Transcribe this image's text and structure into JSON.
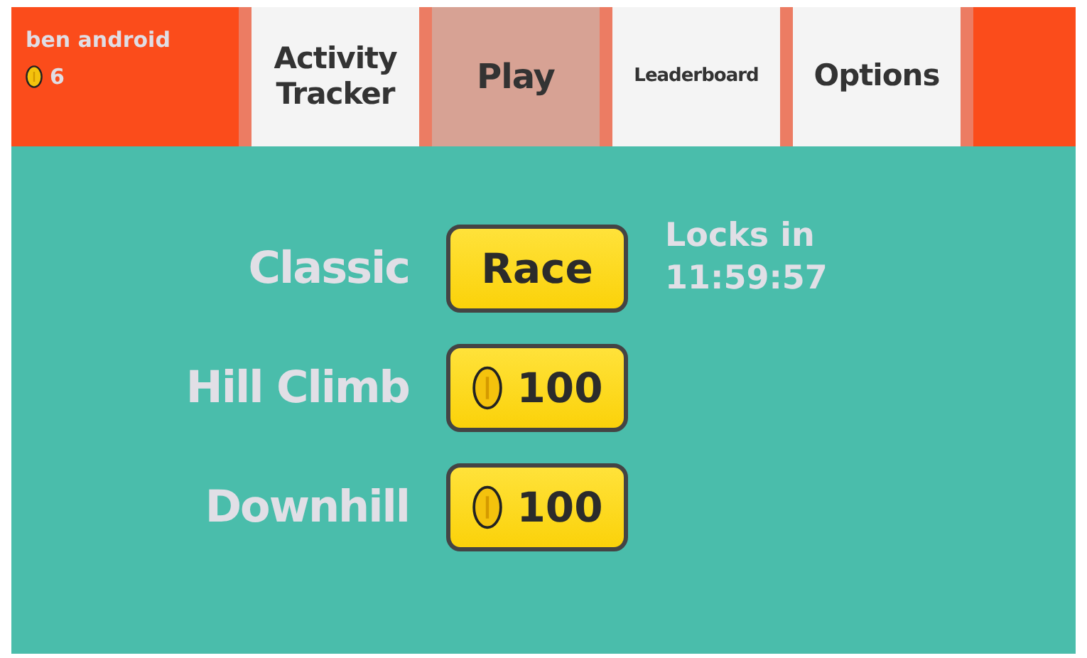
{
  "user": {
    "name": "ben android",
    "coins": "6"
  },
  "tabs": [
    {
      "label": "Activity Tracker",
      "selected": false
    },
    {
      "label": "Play",
      "selected": true
    },
    {
      "label": "Leaderboard",
      "selected": false
    },
    {
      "label": "Options",
      "selected": false
    }
  ],
  "modes": [
    {
      "name": "Classic",
      "kind": "text",
      "button": "Race"
    },
    {
      "name": "Hill Climb",
      "kind": "price",
      "button": "100"
    },
    {
      "name": "Downhill",
      "kind": "price",
      "button": "100"
    }
  ],
  "lock_notice": {
    "label": "Locks in",
    "time": "11:59:57"
  }
}
